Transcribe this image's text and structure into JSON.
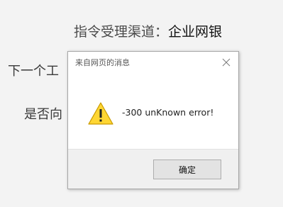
{
  "background": {
    "line1_label": "指令受理渠道：",
    "line1_value": "企业网银",
    "line2_visible": "下一个工",
    "line3_visible": "是否向"
  },
  "dialog": {
    "title": "来自网页的消息",
    "message": "-300 unKnown error!",
    "ok_label": "确定",
    "icons": {
      "close": "close-icon",
      "warning": "warning-icon"
    },
    "colors": {
      "warning_fill": "#ffd633",
      "warning_stroke": "#c99a00"
    }
  }
}
